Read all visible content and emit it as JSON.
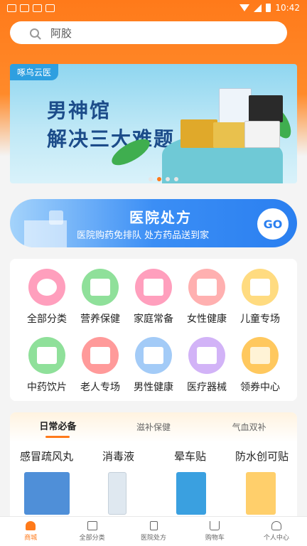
{
  "status_bar": {
    "time": "10:42"
  },
  "search": {
    "placeholder": "阿胶"
  },
  "banner": {
    "tag": "啄乌云医",
    "title_line1": "男神馆",
    "title_line2": "解决三大难题",
    "dots": 4,
    "active_dot": 1
  },
  "hospital": {
    "title": "医院处方",
    "subtitle": "医院购药免排队  处方药品送到家",
    "button": "GO"
  },
  "categories": [
    {
      "label": "全部分类",
      "icon": "clover-icon",
      "color": "#ff8fb1"
    },
    {
      "label": "营养保健",
      "icon": "supplement-bottle-icon",
      "color": "#7fd98a"
    },
    {
      "label": "家庭常备",
      "icon": "medicine-box-icon",
      "color": "#ff8fb1"
    },
    {
      "label": "女性健康",
      "icon": "women-health-icon",
      "color": "#ffa3a3"
    },
    {
      "label": "儿童专场",
      "icon": "child-medicine-icon",
      "color": "#ffd36b"
    },
    {
      "label": "中药饮片",
      "icon": "herbal-slice-icon",
      "color": "#7fd98a"
    },
    {
      "label": "老人专场",
      "icon": "elderly-medicine-icon",
      "color": "#ff8a8a"
    },
    {
      "label": "男性健康",
      "icon": "men-health-icon",
      "color": "#8fbff5"
    },
    {
      "label": "医疗器械",
      "icon": "blood-pressure-monitor-icon",
      "color": "#c9a3f5"
    },
    {
      "label": "领券中心",
      "icon": "coupon-icon",
      "color": "#ffc04d"
    }
  ],
  "daily": {
    "tabs": [
      "日常必备",
      "滋补保健",
      "气血双补"
    ],
    "active_tab": 0,
    "products": [
      {
        "name": "感冒疏风丸",
        "color": "#4f8fd8"
      },
      {
        "name": "消毒液",
        "color": "#dfe8f0"
      },
      {
        "name": "晕车贴",
        "color": "#3aa0e0"
      },
      {
        "name": "防水创可贴",
        "color": "#ffcf6b"
      }
    ]
  },
  "bottom_nav": [
    {
      "label": "商城",
      "icon": "home-icon"
    },
    {
      "label": "全部分类",
      "icon": "grid-icon"
    },
    {
      "label": "医院处方",
      "icon": "prescription-icon"
    },
    {
      "label": "购物车",
      "icon": "cart-icon"
    },
    {
      "label": "个人中心",
      "icon": "user-icon"
    }
  ],
  "accent": "#ff7a1a"
}
